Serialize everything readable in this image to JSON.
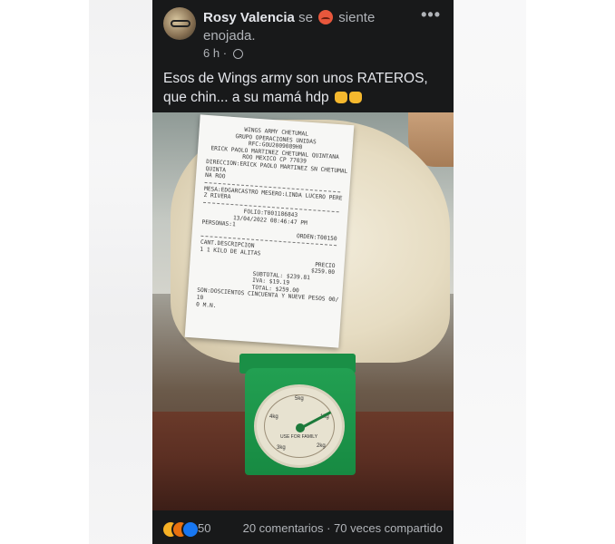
{
  "post": {
    "author": "Rosy Valencia",
    "feeling_prefix": "se",
    "feeling_text": "siente enojada.",
    "time": "6 h",
    "time_sep": "·",
    "more": "•••",
    "text": "Esos de Wings army son unos RATEROS, que chin... a su mamá hdp"
  },
  "receipt": {
    "lines": [
      "WINGS ARMY CHETUMAL",
      "GRUPO OPERACIONES UNIDAS",
      "RFC:GOU2009089H0",
      "ERICK PAOLO MARTINEZ CHETUMAL QUINTANA",
      "ROO MEXICO CP 77039",
      "DIRECCION:ERICK PAOLO MARTINEZ SN CHETUMAL",
      "QUINTA",
      "NA ROO"
    ],
    "mesa": "MESA:EDGARCASTRO  MESERO:LINDA LUCERO PERE",
    "mesa2": "Z RIVERA",
    "folio": "FOLIO:T001186843",
    "fecha": "13/04/2022 08:46:47 PM",
    "orden": "ORDEN:T00150",
    "personas": "PERSONAS:1",
    "header_cols": "CANT.DESCRIPCION",
    "item": "1   1 KILO DE ALITAS",
    "precio_label": "PRECIO",
    "precio": "$259.00",
    "subtotal_label": "SUBTOTAL:",
    "subtotal": "$239.81",
    "iva_label": "IVA:",
    "iva": "$19.19",
    "total_label": "TOTAL:",
    "total": "$259.00",
    "letras": "SON:DOSCIENTOS CINCUENTA Y NUEVE PESOS 00/",
    "letras2": "10",
    "letras3": "0 M.N."
  },
  "scale": {
    "label": "USE FOR FAMILY",
    "marks": [
      "5kg",
      "1kg",
      "2kg",
      "3kg",
      "4kg"
    ]
  },
  "footer": {
    "reaction_count": "50",
    "comments": "20 comentarios · 70 veces compartido"
  },
  "icons": [
    "feeling-angry-icon",
    "globe-icon",
    "more-options-icon",
    "fist-icon",
    "wow-reaction-icon",
    "angry-reaction-icon",
    "like-reaction-icon"
  ],
  "colors": {
    "post_bg": "#18191a",
    "text_primary": "#e4e6eb",
    "text_secondary": "#b0b3b8",
    "like_blue": "#1877f2"
  }
}
